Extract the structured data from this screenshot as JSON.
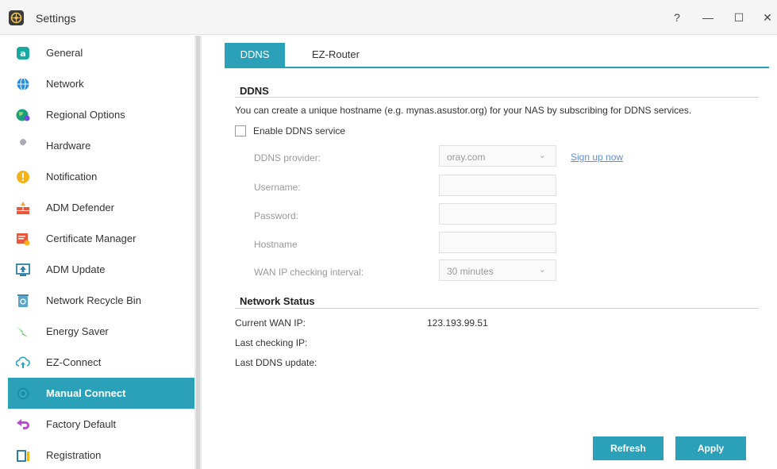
{
  "window": {
    "title": "Settings",
    "controls": {
      "help": "?",
      "minimize": "—",
      "maximize": "☐",
      "close": "✕"
    }
  },
  "sidebar": {
    "items": [
      {
        "label": "General",
        "icon": "general-icon"
      },
      {
        "label": "Network",
        "icon": "globe-icon"
      },
      {
        "label": "Regional Options",
        "icon": "regional-globe-icon"
      },
      {
        "label": "Hardware",
        "icon": "wrench-icon"
      },
      {
        "label": "Notification",
        "icon": "alert-icon"
      },
      {
        "label": "ADM Defender",
        "icon": "firewall-icon"
      },
      {
        "label": "Certificate Manager",
        "icon": "certificate-icon"
      },
      {
        "label": "ADM Update",
        "icon": "update-icon"
      },
      {
        "label": "Network Recycle Bin",
        "icon": "recycle-bin-icon"
      },
      {
        "label": "Energy Saver",
        "icon": "energy-icon"
      },
      {
        "label": "EZ-Connect",
        "icon": "cloud-upload-icon"
      },
      {
        "label": "Manual Connect",
        "icon": "manual-connect-icon",
        "active": true
      },
      {
        "label": "Factory Default",
        "icon": "undo-arrow-icon"
      },
      {
        "label": "Registration",
        "icon": "registration-icon"
      }
    ]
  },
  "tabs": [
    {
      "label": "DDNS",
      "active": true
    },
    {
      "label": "EZ-Router",
      "active": false
    }
  ],
  "ddns": {
    "section_title": "DDNS",
    "description": "You can create a unique hostname (e.g. mynas.asustor.org) for your NAS by subscribing for DDNS services.",
    "enable_label": "Enable DDNS service",
    "enabled": false,
    "provider_label": "DDNS provider:",
    "provider_value": "oray.com",
    "signup_link": "Sign up now",
    "username_label": "Username:",
    "username_value": "",
    "password_label": "Password:",
    "password_value": "",
    "hostname_label": "Hostname",
    "hostname_value": "",
    "interval_label": "WAN IP checking interval:",
    "interval_value": "30 minutes"
  },
  "network_status": {
    "section_title": "Network Status",
    "current_wan_ip_label": "Current WAN IP:",
    "current_wan_ip_value": "123.193.99.51",
    "last_checking_ip_label": "Last checking IP:",
    "last_checking_ip_value": "",
    "last_ddns_update_label": "Last DDNS update:",
    "last_ddns_update_value": ""
  },
  "buttons": {
    "refresh": "Refresh",
    "apply": "Apply"
  },
  "colors": {
    "accent": "#2aa1b9",
    "link": "#5c8fd6"
  }
}
